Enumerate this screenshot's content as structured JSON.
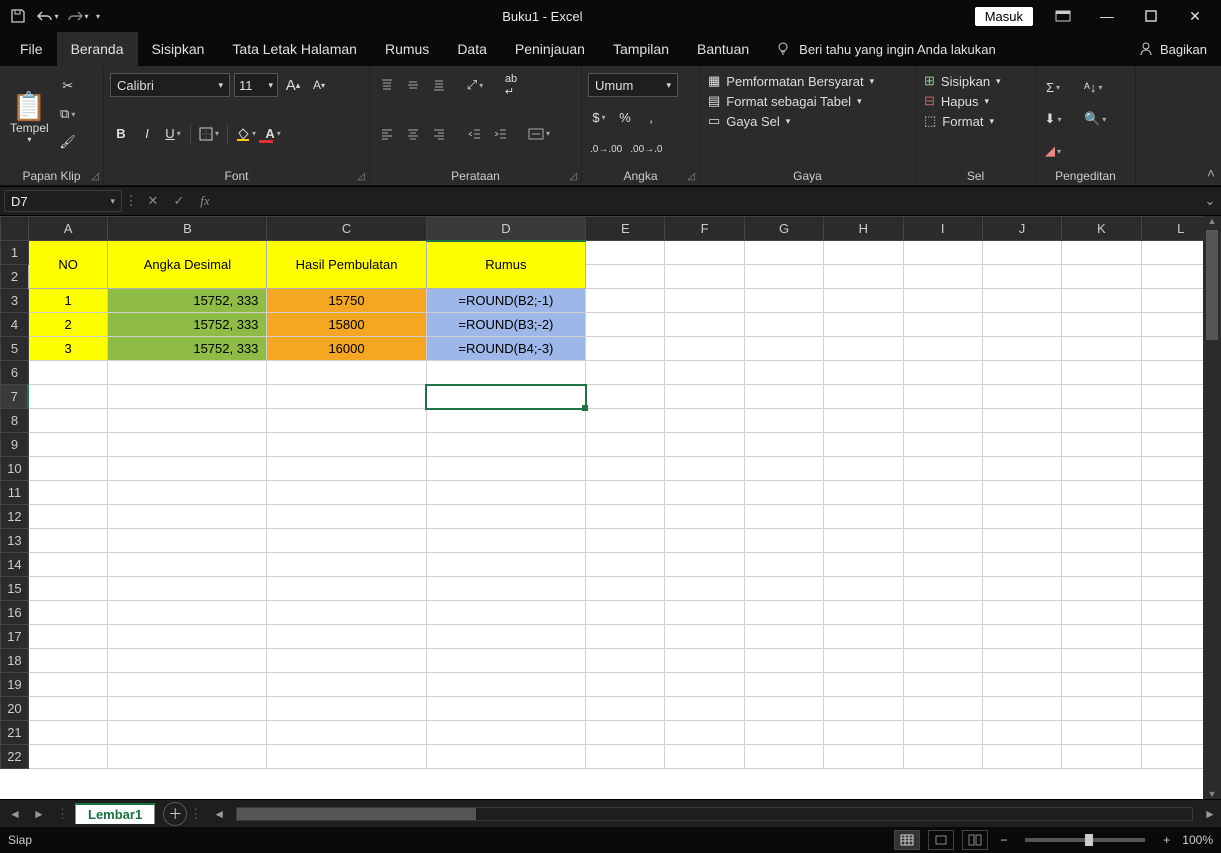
{
  "title": "Buku1  -  Excel",
  "signin": "Masuk",
  "tabs": [
    "File",
    "Beranda",
    "Sisipkan",
    "Tata Letak Halaman",
    "Rumus",
    "Data",
    "Peninjauan",
    "Tampilan",
    "Bantuan"
  ],
  "active_tab": "Beranda",
  "tell_me": "Beri tahu yang ingin Anda lakukan",
  "share": "Bagikan",
  "ribbon": {
    "clipboard": {
      "label": "Papan Klip",
      "paste": "Tempel"
    },
    "font": {
      "label": "Font",
      "name": "Calibri",
      "size": "11"
    },
    "alignment": {
      "label": "Perataan"
    },
    "number": {
      "label": "Angka",
      "format": "Umum"
    },
    "styles": {
      "label": "Gaya",
      "cond": "Pemformatan Bersyarat",
      "table": "Format sebagai Tabel",
      "cell": "Gaya Sel"
    },
    "cells": {
      "label": "Sel",
      "insert": "Sisipkan",
      "delete": "Hapus",
      "format": "Format"
    },
    "editing": {
      "label": "Pengeditan"
    }
  },
  "name_box": "D7",
  "formula": "",
  "columns": [
    "A",
    "B",
    "C",
    "D",
    "E",
    "F",
    "G",
    "H",
    "I",
    "J",
    "K",
    "L"
  ],
  "rows_count": 22,
  "headers": {
    "A": "NO",
    "B": "Angka Desimal",
    "C": "Hasil Pembulatan",
    "D": "Rumus"
  },
  "data_rows": [
    {
      "no": "1",
      "desimal": "15752, 333",
      "hasil": "15750",
      "rumus": "=ROUND(B2;-1)"
    },
    {
      "no": "2",
      "desimal": "15752, 333",
      "hasil": "15800",
      "rumus": "=ROUND(B3;-2)"
    },
    {
      "no": "3",
      "desimal": "15752, 333",
      "hasil": "16000",
      "rumus": "=ROUND(B4;-3)"
    }
  ],
  "active_cell": "D7",
  "sheet_tab": "Lembar1",
  "status_text": "Siap",
  "zoom": "100%"
}
